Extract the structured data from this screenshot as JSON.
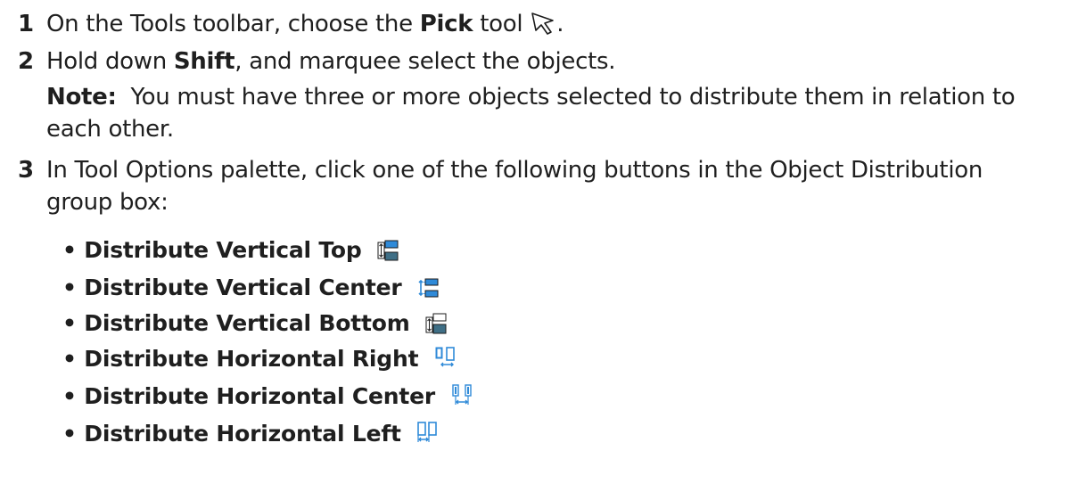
{
  "steps": [
    {
      "number": "1",
      "pre": "On the Tools toolbar, choose the ",
      "bold": "Pick",
      "post": " tool",
      "trail": ".",
      "icon": "pick-tool-arrow-icon"
    },
    {
      "number": "2",
      "pre": "Hold down ",
      "bold": "Shift",
      "post": ", and marquee select the objects."
    },
    {
      "number": "3",
      "line1": "In Tool Options palette, click one of the following buttons in the Object Distribution",
      "line2": "group box:"
    }
  ],
  "note": {
    "label": "Note:",
    "line1": "  You must have three or more objects selected to distribute them in relation to",
    "line2": "each other."
  },
  "buttons": [
    {
      "label": "• Distribute Vertical Top",
      "icon": "distribute-vertical-top-icon"
    },
    {
      "label": "• Distribute Vertical Center",
      "icon": "distribute-vertical-center-icon"
    },
    {
      "label": "• Distribute Vertical Bottom",
      "icon": "distribute-vertical-bottom-icon"
    },
    {
      "label": "• Distribute Horizontal Right",
      "icon": "distribute-horizontal-right-icon"
    },
    {
      "label": "• Distribute Horizontal Center",
      "icon": "distribute-horizontal-center-icon"
    },
    {
      "label": "• Distribute Horizontal Left",
      "icon": "distribute-horizontal-left-icon"
    }
  ],
  "colors": {
    "text": "#1f1f1f",
    "icon_dark": "#3f6f86",
    "icon_light": "#2f8ad8",
    "icon_outline": "#1b1b1b"
  }
}
